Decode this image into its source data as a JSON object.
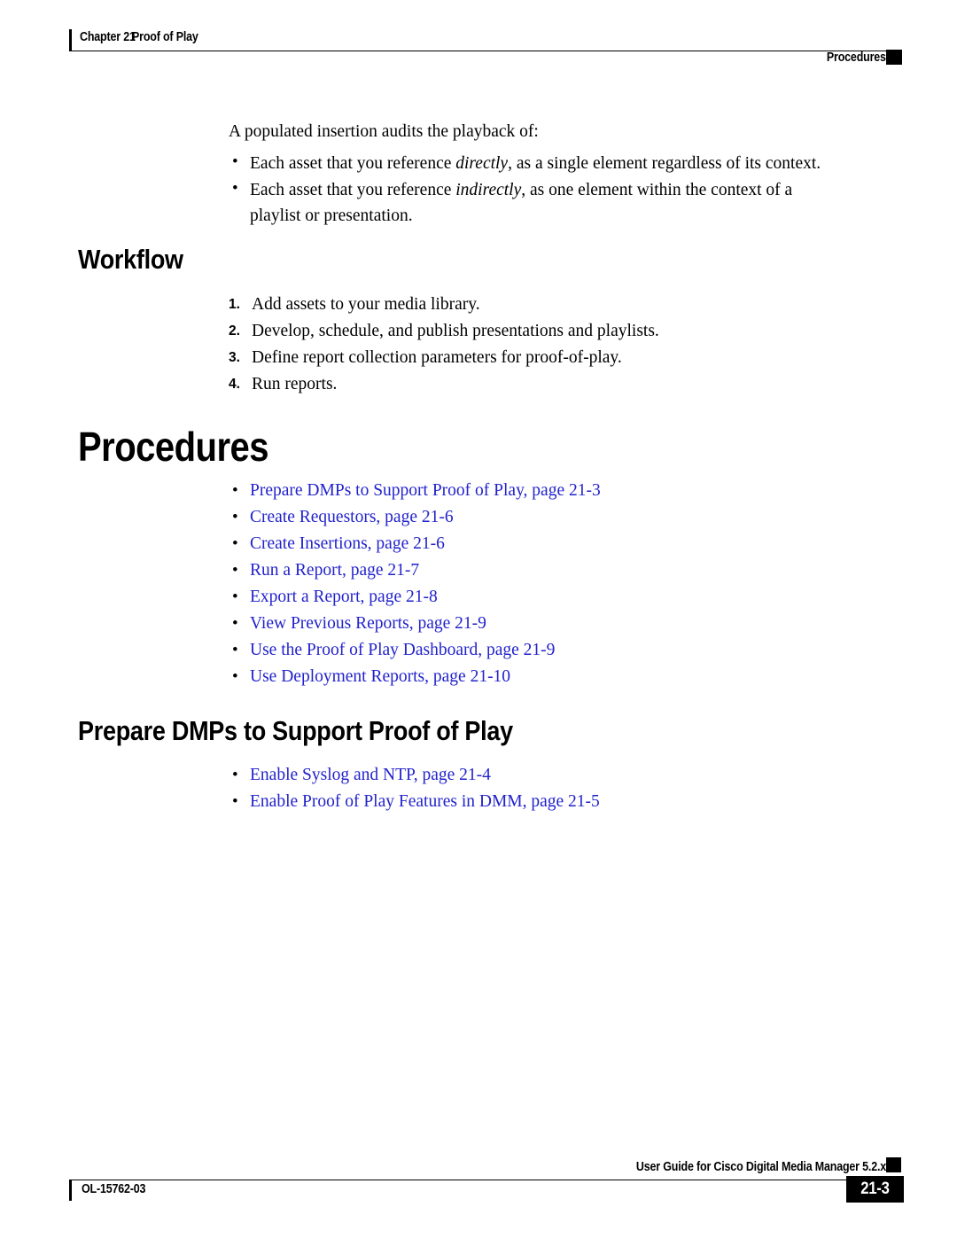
{
  "header": {
    "chapter": "Chapter 21",
    "chapter_title": "Proof of Play",
    "section_marker": "Procedures"
  },
  "body": {
    "intro_paragraph": "A populated insertion audits the playback of:",
    "intro_bullets": [
      {
        "prefix": "Each asset that you reference ",
        "emphasis": "directly",
        "suffix": ", as a single element regardless of its context."
      },
      {
        "prefix": "Each asset that you reference ",
        "emphasis": "indirectly",
        "suffix": ", as one element within the context of a playlist or presentation."
      }
    ],
    "bullet_glyph": "•"
  },
  "workflow": {
    "heading": "Workflow",
    "steps": [
      {
        "number": "1.",
        "text": "Add assets to your media library."
      },
      {
        "number": "2.",
        "text": "Develop, schedule, and publish presentations and playlists."
      },
      {
        "number": "3.",
        "text": "Define report collection parameters for proof-of-play."
      },
      {
        "number": "4.",
        "text": "Run reports."
      }
    ]
  },
  "procedures": {
    "heading": "Procedures",
    "links": [
      "Prepare DMPs to Support Proof of Play, page 21-3",
      "Create Requestors, page 21-6",
      "Create Insertions, page 21-6",
      "Run a Report, page 21-7",
      "Export a Report, page 21-8",
      "View Previous Reports, page 21-9",
      "Use the Proof of Play Dashboard, page 21-9",
      "Use Deployment Reports, page 21-10"
    ]
  },
  "prepare_dmps": {
    "heading": "Prepare DMPs to Support Proof of Play",
    "links": [
      "Enable Syslog and NTP, page 21-4",
      "Enable Proof of Play Features in DMM, page 21-5"
    ]
  },
  "footer": {
    "guide_title": "User Guide for Cisco Digital Media Manager 5.2.x",
    "doc_id": "OL-15762-03",
    "page_number": "21-3"
  },
  "colors": {
    "link": "#2222cc",
    "text": "#000000",
    "background": "#ffffff"
  }
}
